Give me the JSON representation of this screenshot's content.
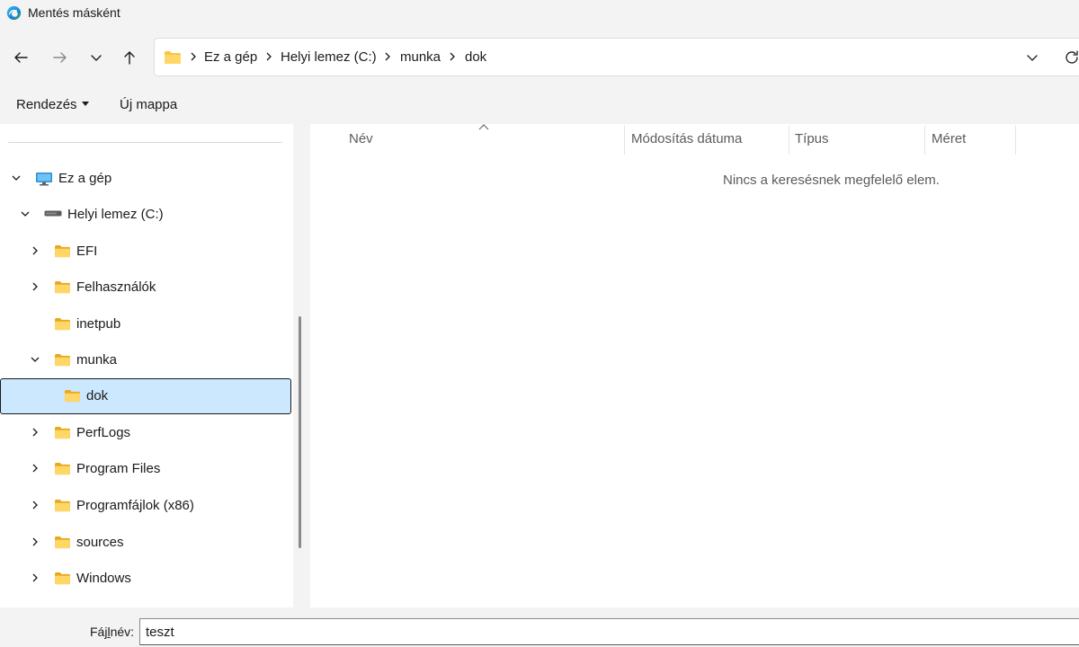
{
  "window": {
    "title": "Mentés másként",
    "app_icon": "edge-browser-icon"
  },
  "nav": {
    "back_icon": "arrow-left-icon",
    "forward_icon": "arrow-right-icon",
    "recent_icon": "chevron-down-icon",
    "up_icon": "arrow-up-icon",
    "breadcrumb": [
      "Ez a gép",
      "Helyi lemez (C:)",
      "munka",
      "dok"
    ],
    "refresh_icon": "refresh-icon"
  },
  "commands": {
    "organize": "Rendezés",
    "new_folder": "Új mappa"
  },
  "sidebar": {
    "items": [
      {
        "label": "Ez a gép",
        "icon": "computer-icon",
        "expanded": true
      },
      {
        "label": "Helyi lemez (C:)",
        "icon": "drive-icon",
        "expanded": true
      },
      {
        "label": "EFI",
        "icon": "folder-icon",
        "expanded": false
      },
      {
        "label": "Felhasználók",
        "icon": "folder-icon",
        "expanded": false
      },
      {
        "label": "inetpub",
        "icon": "folder-icon"
      },
      {
        "label": "munka",
        "icon": "folder-icon",
        "expanded": true
      },
      {
        "label": "dok",
        "icon": "folder-icon",
        "selected": true
      },
      {
        "label": "PerfLogs",
        "icon": "folder-icon",
        "expanded": false
      },
      {
        "label": "Program Files",
        "icon": "folder-icon",
        "expanded": false
      },
      {
        "label": "Programfájlok (x86)",
        "icon": "folder-icon",
        "expanded": false
      },
      {
        "label": "sources",
        "icon": "folder-icon",
        "expanded": false
      },
      {
        "label": "Windows",
        "icon": "folder-icon",
        "expanded": false
      }
    ]
  },
  "list": {
    "columns": [
      "Név",
      "Módosítás dátuma",
      "Típus",
      "Méret"
    ],
    "empty_message": "Nincs a keresésnek megfelelő elem."
  },
  "filename": {
    "label_before": "Fáj",
    "label_accel": "l",
    "label_after": "név:",
    "value": "teszt"
  },
  "colors": {
    "selection": "#cce8ff",
    "folder": "#f8c740",
    "chrome_bg": "#f3f3f3"
  }
}
